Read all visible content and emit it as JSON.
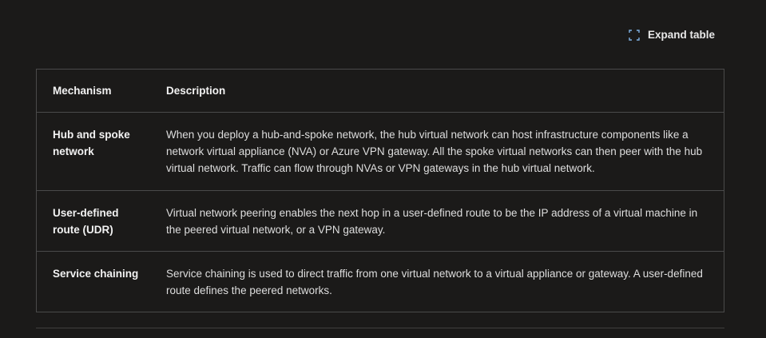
{
  "toolbar": {
    "expand_label": "Expand table",
    "expand_icon": "expand-icon"
  },
  "table": {
    "headers": [
      "Mechanism",
      "Description"
    ],
    "rows": [
      {
        "mechanism": "Hub and spoke network",
        "description": "When you deploy a hub-and-spoke network, the hub virtual network can host infrastructure components like a network virtual appliance (NVA) or Azure VPN gateway. All the spoke virtual networks can then peer with the hub virtual network. Traffic can flow through NVAs or VPN gateways in the hub virtual network."
      },
      {
        "mechanism": "User-defined route (UDR)",
        "description": "Virtual network peering enables the next hop in a user-defined route to be the IP address of a virtual machine in the peered virtual network, or a VPN gateway."
      },
      {
        "mechanism": "Service chaining",
        "description": "Service chaining is used to direct traffic from one virtual network to a virtual appliance or gateway. A user-defined route defines the peered networks."
      }
    ]
  },
  "colors": {
    "background": "#1b1a19",
    "border": "#4a4a4a",
    "text": "#e6e6e6",
    "icon": "#7fb2e5"
  }
}
